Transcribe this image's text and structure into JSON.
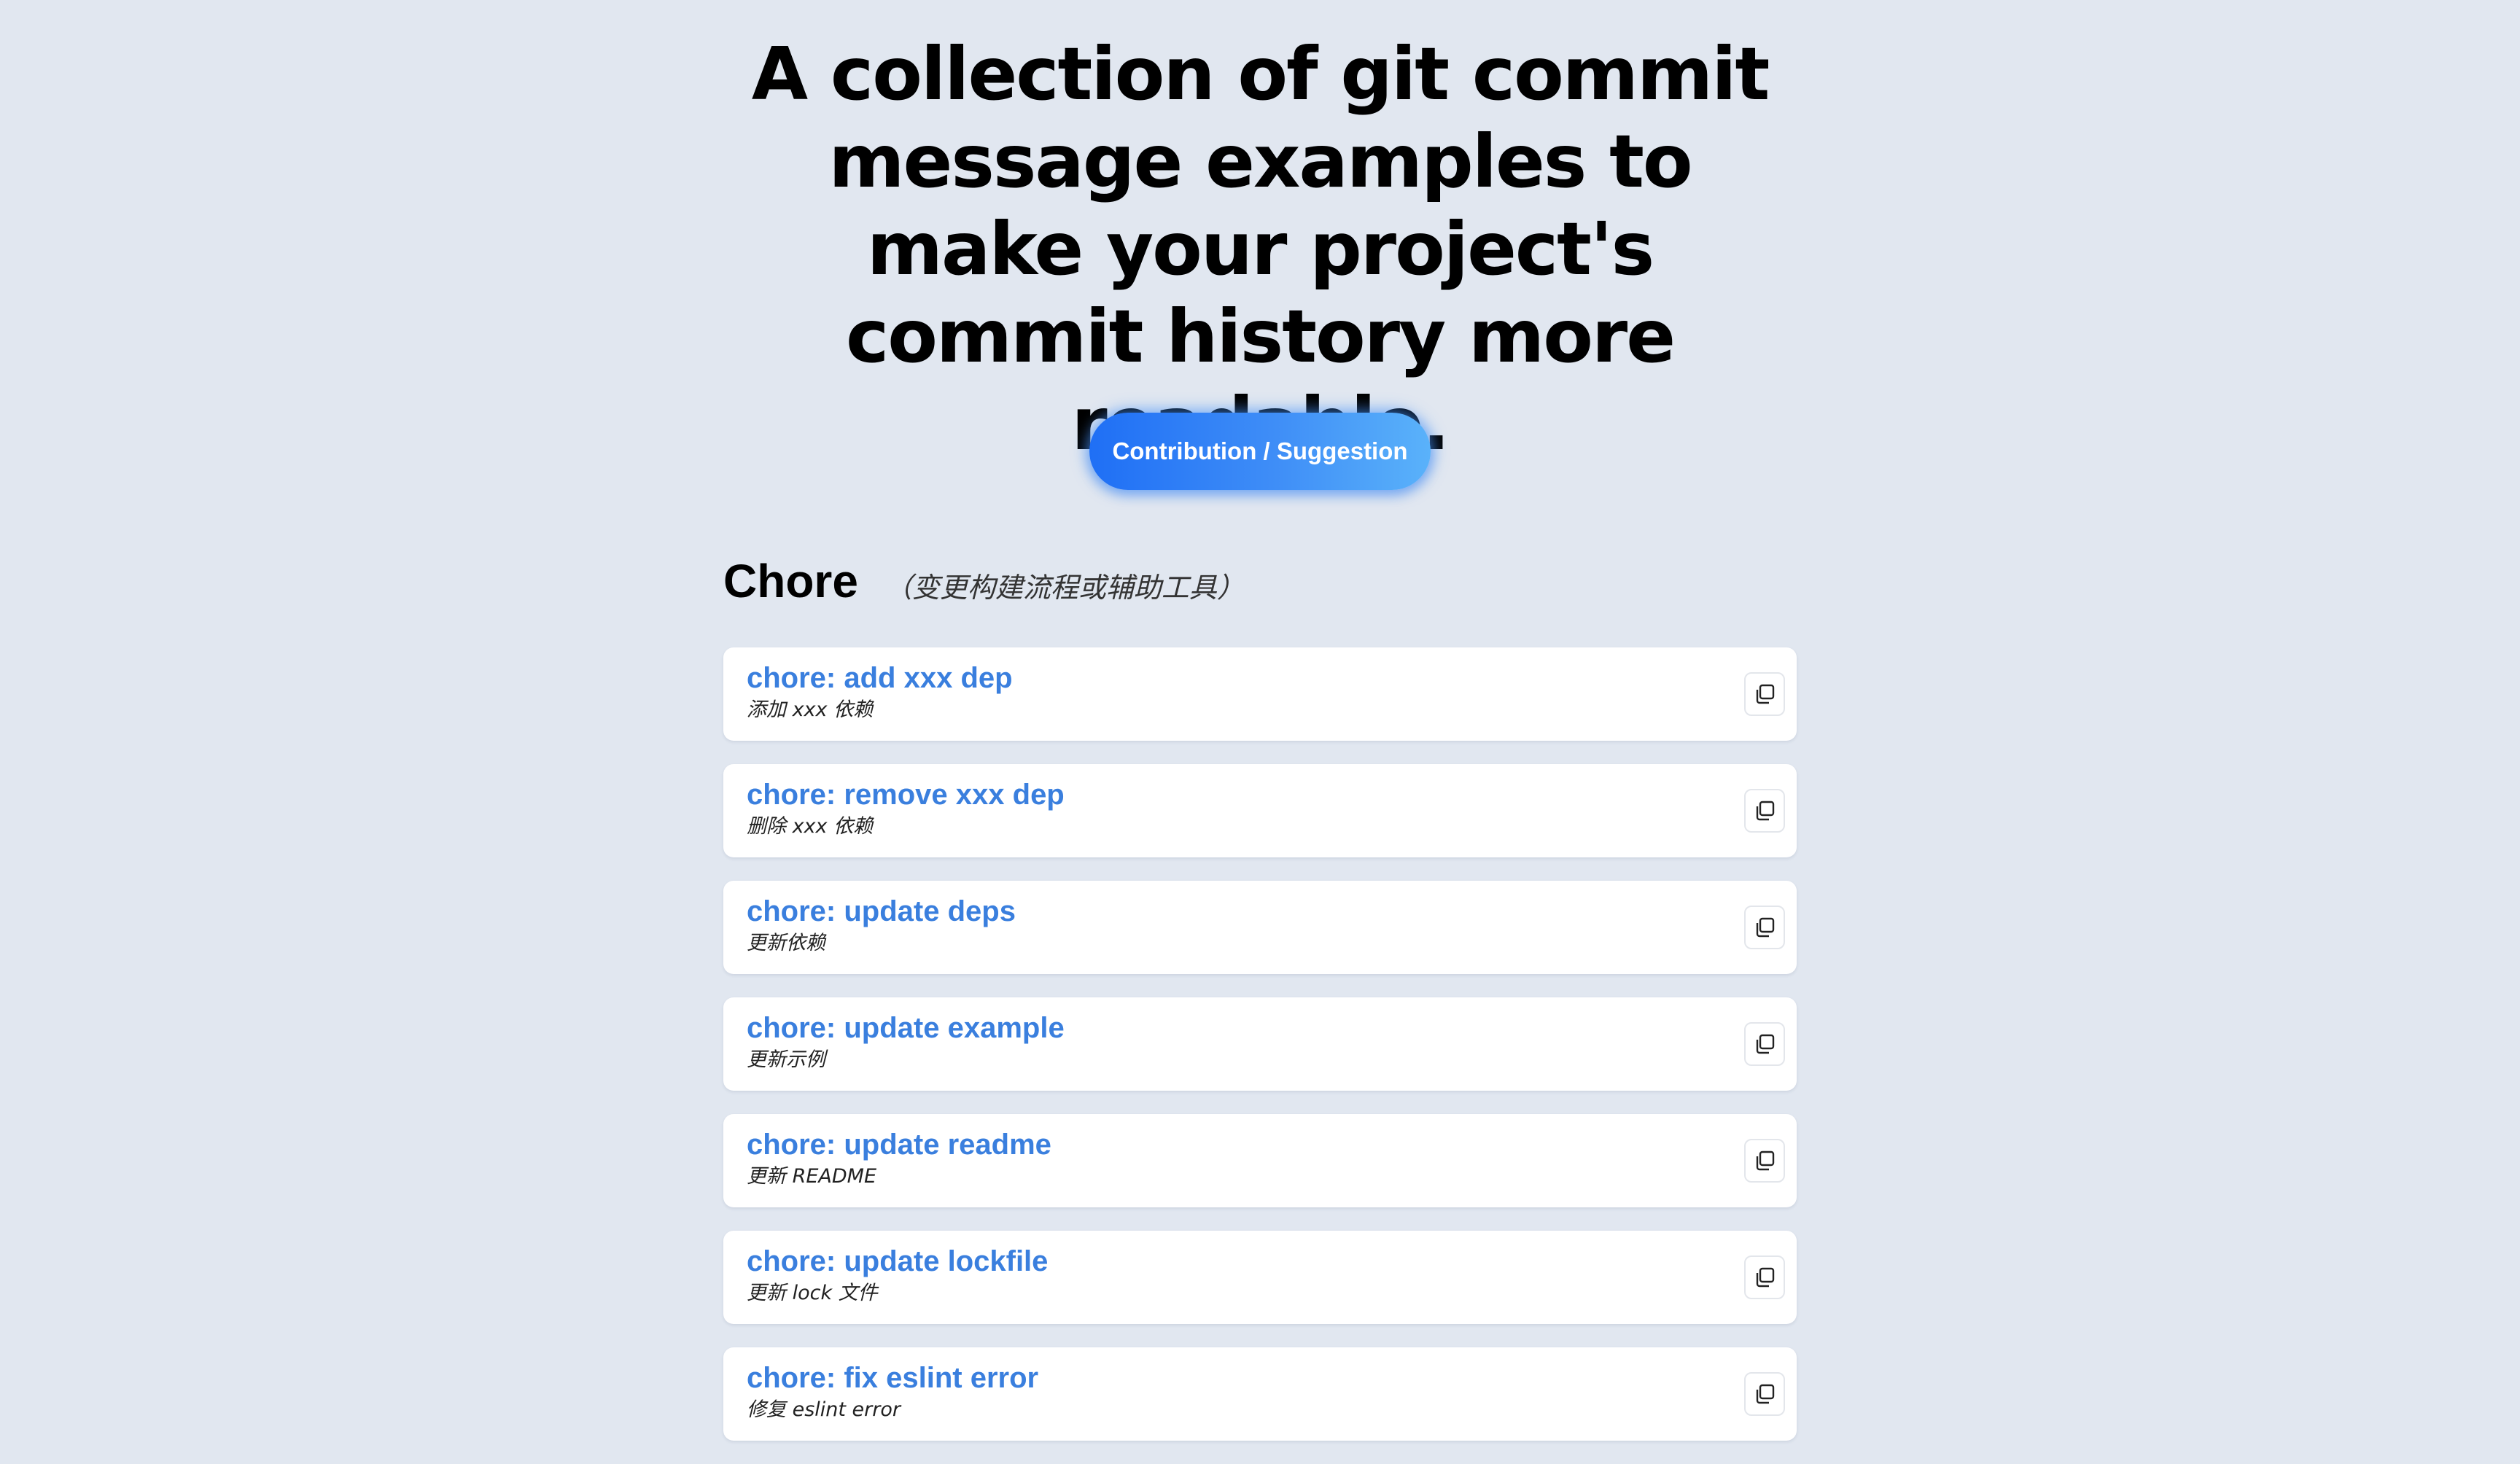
{
  "hero": {
    "title": "A collection of git commit message examples to make your project's commit history more readable.",
    "cta_label": "Contribution / Suggestion"
  },
  "section": {
    "title": "Chore",
    "subtitle": "（变更构建流程或辅助工具）",
    "items": [
      {
        "message": "chore: add xxx dep",
        "description": "添加 xxx 依赖"
      },
      {
        "message": "chore: remove xxx dep",
        "description": "删除 xxx 依赖"
      },
      {
        "message": "chore: update deps",
        "description": "更新依赖"
      },
      {
        "message": "chore: update example",
        "description": "更新示例"
      },
      {
        "message": "chore: update readme",
        "description": "更新 README"
      },
      {
        "message": "chore: update lockfile",
        "description": "更新 lock 文件"
      },
      {
        "message": "chore: fix eslint error",
        "description": "修复 eslint error"
      }
    ]
  },
  "icons": {
    "copy": "copy-icon"
  },
  "colors": {
    "background": "#e1e7f0",
    "accent": "#3a7fde",
    "button_gradient_start": "#1f6ff5",
    "button_gradient_end": "#5ab2fa"
  }
}
